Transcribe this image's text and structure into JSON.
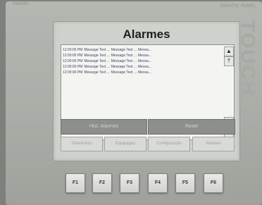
{
  "device": {
    "brand_top": "SIMATIC PANEL",
    "brand_left": "SIEMENS",
    "brand_side": "TOUCH"
  },
  "screen": {
    "title": "Alarmes",
    "alarms": [
      {
        "time": "12:00:00 PM",
        "col1": "Message Text ...",
        "col2": "Message Text ...",
        "col3": "Messa..."
      },
      {
        "time": "12:00:00 PM",
        "col1": "Message Text ...",
        "col2": "Message Text ...",
        "col3": "Messa..."
      },
      {
        "time": "12:00:00 PM",
        "col1": "Message Text ...",
        "col2": "Message Text ...",
        "col3": "Messa..."
      },
      {
        "time": "12:00:00 PM",
        "col1": "Message Text ...",
        "col2": "Message Text ...",
        "col3": "Messa..."
      },
      {
        "time": "12:00:00 PM",
        "col1": "Message Text ...",
        "col2": "Message Text ...",
        "col3": "Messa..."
      }
    ],
    "scroll": {
      "up": "▲",
      "page_up": "⤒",
      "page_down": "⤓",
      "down": "▼"
    },
    "buttons": {
      "history": "Hist. Alarmes",
      "reset": "Reset"
    },
    "nav": [
      "Telas/Inicio",
      "Equipagos",
      "Configuração",
      "Alarmes"
    ]
  },
  "function_keys": [
    "F1",
    "F2",
    "F3",
    "F4",
    "F5",
    "F6"
  ]
}
